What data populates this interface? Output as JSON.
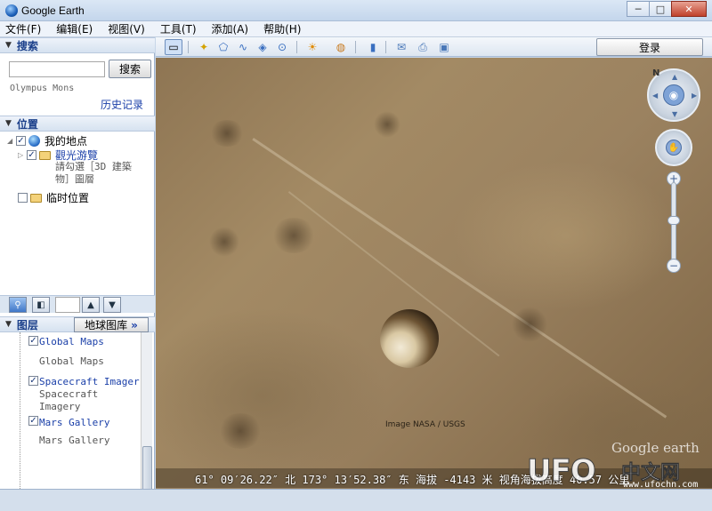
{
  "window": {
    "title": "Google Earth",
    "controls": {
      "minimize": "─",
      "maximize": "□",
      "close": "✕"
    }
  },
  "menu": [
    "文件(F)",
    "编辑(E)",
    "视图(V)",
    "工具(T)",
    "添加(A)",
    "帮助(H)"
  ],
  "search": {
    "header": "搜索",
    "button": "搜索",
    "recent": "Olympus Mons",
    "history_link": "历史记录"
  },
  "places": {
    "header": "位置",
    "my_places": "我的地点",
    "tour": "觀光游覽",
    "tour_hint": [
      "請勾選［3D 建築",
      "物］圖層"
    ],
    "temp": "临时位置"
  },
  "layers": {
    "header": "图层",
    "gallery_button": "地球图库",
    "gallery_arrows": "»",
    "items": [
      {
        "title": "Global  Maps",
        "desc": [
          "Global Maps"
        ]
      },
      {
        "title": "Spacecraft  Imager",
        "desc": [
          "Spacecraft",
          "Imagery"
        ]
      },
      {
        "title": "Mars  Gallery",
        "desc": [
          "Mars Gallery"
        ]
      }
    ]
  },
  "toolbar": {
    "login": "登录",
    "icons": [
      "sidebar-toggle-icon",
      "placemark-icon",
      "polygon-icon",
      "path-icon",
      "overlay-icon",
      "record-tour-icon",
      "sun-icon",
      "planet-icon",
      "ruler-icon",
      "email-icon",
      "print-icon",
      "view-in-maps-icon"
    ]
  },
  "map": {
    "credit": "Image NASA / USGS",
    "logo": "Google earth",
    "nav_north": "N",
    "status": "61° 09′26.22″ 北 173° 13′52.38″ 东 海拔 -4143 米   视角海拔高度  40.57 公里"
  },
  "watermark": {
    "brand": "UFO",
    "cn": "中文网",
    "url": "www.ufochn.com"
  },
  "colors": {
    "accent": "#1a3fa8",
    "mars_terrain": "#9b8260"
  }
}
